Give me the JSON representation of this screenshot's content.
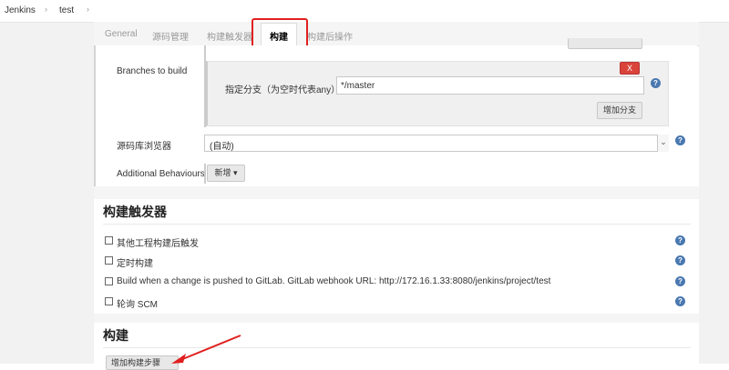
{
  "breadcrumb": {
    "items": [
      "Jenkins",
      "test"
    ],
    "separator": "›"
  },
  "tabs": [
    {
      "label": "General"
    },
    {
      "label": "源码管理"
    },
    {
      "label": "构建触发器"
    },
    {
      "label": "构建"
    },
    {
      "label": "构建后操作"
    }
  ],
  "scm": {
    "branches_label": "Branches to build",
    "branch_spec_label": "指定分支（为空时代表any）",
    "branch_spec_value": "*/master",
    "delete_branch_label": "X",
    "add_branch_label": "增加分支",
    "repo_browser_label": "源码库浏览器",
    "repo_browser_value": "(自动)",
    "additional_behaviours_label": "Additional Behaviours",
    "add_behaviour_label": "新增"
  },
  "triggers": {
    "title": "构建触发器",
    "items": [
      {
        "label": "其他工程构建后触发"
      },
      {
        "label": "定时构建"
      },
      {
        "label": "Build when a change is pushed to GitLab. GitLab webhook URL: http://172.16.1.33:8080/jenkins/project/test"
      },
      {
        "label": "轮询 SCM"
      }
    ]
  },
  "build": {
    "title": "构建",
    "add_step_label": "增加构建步骤"
  },
  "icons": {
    "help": "help-icon",
    "dropdown": "chevron-down-icon",
    "arrow": "red-arrow-annotation"
  },
  "colors": {
    "highlight": "#e02020",
    "help": "#4a78b0",
    "delete": "#d9433a"
  }
}
